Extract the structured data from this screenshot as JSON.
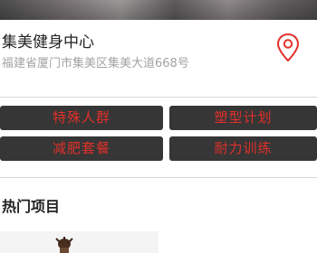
{
  "hero": {
    "image": "gym-banner"
  },
  "gym": {
    "name": "集美健身中心",
    "address": "福建省厦门市集美区集美大道668号",
    "location_icon": "map-pin-icon",
    "accent_color": "#e0302a"
  },
  "categories": {
    "items": [
      {
        "label": "特殊人群"
      },
      {
        "label": "塑型计划"
      },
      {
        "label": "减肥套餐"
      },
      {
        "label": "耐力训练"
      }
    ],
    "button_bg": "#363636",
    "text_color": "#e0302a"
  },
  "hot": {
    "title": "热门项目",
    "thumbnail": "hot-item-thumbnail"
  }
}
